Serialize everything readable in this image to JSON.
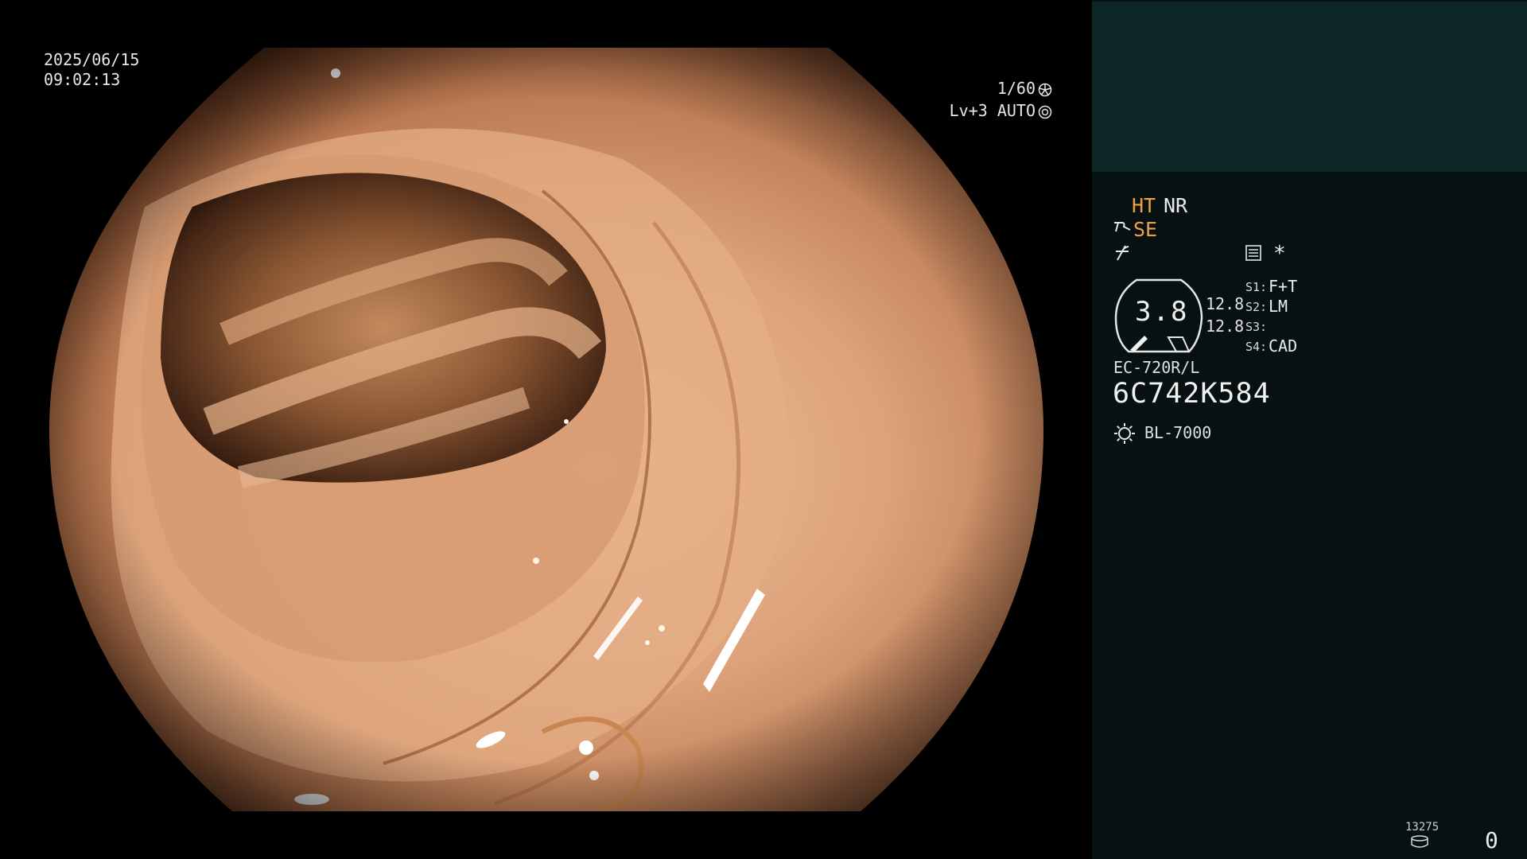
{
  "osd": {
    "date": "2025/06/15",
    "time": "09:02:13",
    "shutter": "1/60",
    "level": "Lv+3 AUTO",
    "shutter_icon": "aperture-icon",
    "auto_icon": "iris-icon"
  },
  "panel": {
    "ht": "HT",
    "nr": "NR",
    "se": "SE",
    "star": "*",
    "gauge_value": "3.8",
    "value_a": "12.8",
    "value_b": "12.8",
    "s1": {
      "label": "S1:",
      "value": "F+T"
    },
    "s2": {
      "label": "S2:",
      "value": "LM"
    },
    "s3": {
      "label": "S3:",
      "value": ""
    },
    "s4": {
      "label": "S4:",
      "value": "CAD"
    },
    "model": "EC-720R/L",
    "serial": "6C742K584",
    "light_source": "BL-7000",
    "counter": "13275",
    "zero": "0"
  },
  "colors": {
    "accent": "#f0a040",
    "panel_bg": "#081111",
    "preview_bg": "#0d2626",
    "tissue": "#d9a078"
  }
}
